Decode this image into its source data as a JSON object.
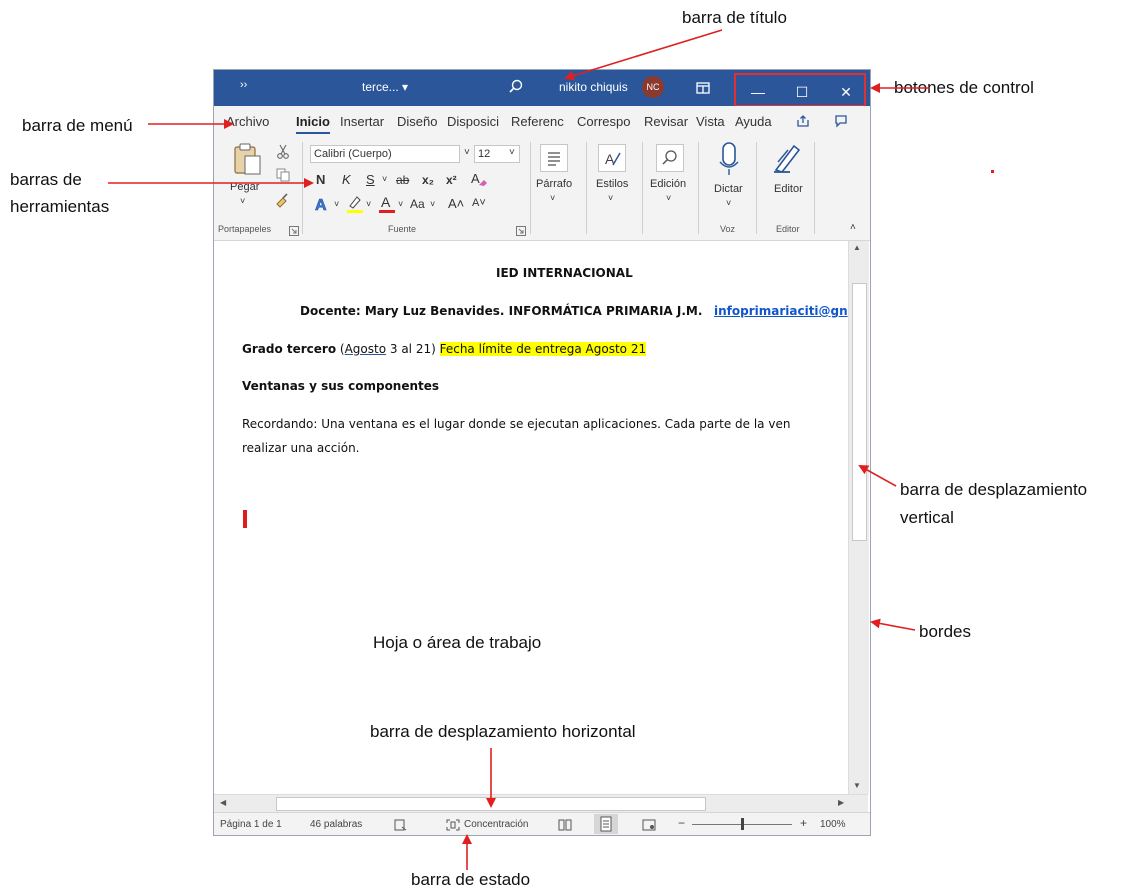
{
  "annotations": {
    "title_bar": "barra de título",
    "control_buttons": "botones de control",
    "menu_bar": "barra de menú",
    "toolbars_line1": "barras de",
    "toolbars_line2": "herramientas",
    "vscroll_line1": "barra de desplazamiento",
    "vscroll_line2": "vertical",
    "borders": "bordes",
    "work_area": "Hoja o área de trabajo",
    "hscroll": "barra de desplazamiento horizontal",
    "status_bar": "barra de estado"
  },
  "annotation_color": "#e02020",
  "window": {
    "accent": "#2b579a",
    "overflow_glyph": "››",
    "doc_title": "terce... ▾",
    "user_name": "nikito chiquis",
    "avatar_initials": "NC",
    "avatar_color": "#8b3a2e",
    "minimize": "—",
    "maximize": "☐",
    "close": "✕"
  },
  "menu": {
    "tabs": [
      "Archivo",
      "Inicio",
      "Insertar",
      "Diseño",
      "Disposici",
      "Referenc",
      "Correspo",
      "Revisar",
      "Vista",
      "Ayuda"
    ]
  },
  "ribbon": {
    "paste_label": "Pegar",
    "font_name": "Calibri (Cuerpo)",
    "font_size": "12",
    "bold": "N",
    "italic": "K",
    "underline": "S",
    "strike": "ab",
    "subscript": "x₂",
    "superscript": "x²",
    "grow_font": "A˄",
    "shrink_font": "A˅",
    "change_case": "Aa",
    "paragraph": "Párrafo",
    "styles": "Estilos",
    "editing": "Edición",
    "dictate": "Dictar",
    "editor": "Editor",
    "groups": {
      "clipboard": "Portapapeles",
      "font": "Fuente",
      "voice": "Voz",
      "editor": "Editor"
    }
  },
  "document": {
    "heading": "IED INTERNACIONAL",
    "teacher_prefix": "Docente: Mary Luz Benavides. INFORMÁTICA PRIMARIA J.M.",
    "teacher_email": "infoprimariaciti@gn",
    "grade_bold": "Grado tercero",
    "grade_paren_open": " (",
    "grade_month": "Agosto",
    "grade_rest": " 3 al 21) ",
    "deadline": "Fecha límite de entrega Agosto 21",
    "section_title": "Ventanas y sus componentes",
    "body_line1": "Recordando: Una ventana es el lugar donde se ejecutan aplicaciones. Cada parte de la ven",
    "body_line2": "realizar una acción.",
    "highlight_color": "#ffff00",
    "link_color": "#1155cc"
  },
  "status": {
    "page": "Página 1 de 1",
    "words": "46 palabras",
    "focus": "Concentración",
    "zoom_minus": "−",
    "zoom_plus": "+",
    "zoom": "100%",
    "zoom_level_percent": 100
  }
}
